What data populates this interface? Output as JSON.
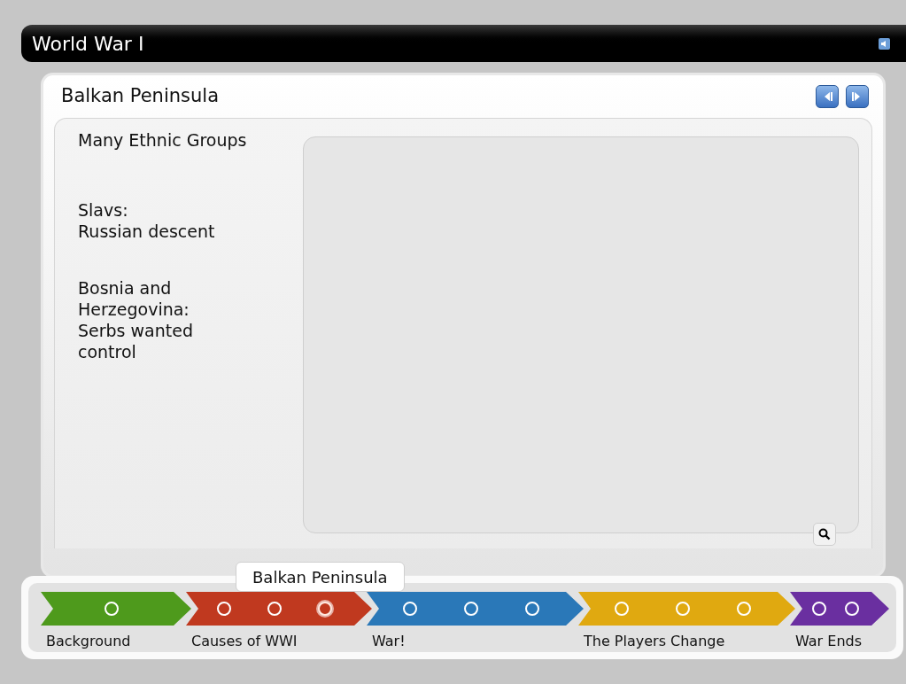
{
  "window": {
    "title": "World War I"
  },
  "panel": {
    "title": "Balkan Peninsula"
  },
  "content": {
    "heading": "Many Ethnic Groups",
    "paragraphs": [
      "Slavs:\nRussian descent",
      "Bosnia and\nHerzegovina:\nSerbs wanted\ncontrol"
    ]
  },
  "tooltip": "Balkan Peninsula",
  "timeline": [
    {
      "label": "Background",
      "color": "#4e9a1c",
      "points": [
        {
          "selected": false
        }
      ]
    },
    {
      "label": "Causes of WWI",
      "color": "#c0391f",
      "points": [
        {
          "selected": false
        },
        {
          "selected": false
        },
        {
          "selected": true
        }
      ]
    },
    {
      "label": "War!",
      "color": "#2a78b8",
      "points": [
        {
          "selected": false
        },
        {
          "selected": false
        },
        {
          "selected": false
        }
      ]
    },
    {
      "label": "The Players Change",
      "color": "#e0a910",
      "points": [
        {
          "selected": false
        },
        {
          "selected": false
        },
        {
          "selected": false
        }
      ]
    },
    {
      "label": "War Ends",
      "color": "#6a2fa0",
      "points": [
        {
          "selected": false
        },
        {
          "selected": false
        }
      ]
    }
  ]
}
